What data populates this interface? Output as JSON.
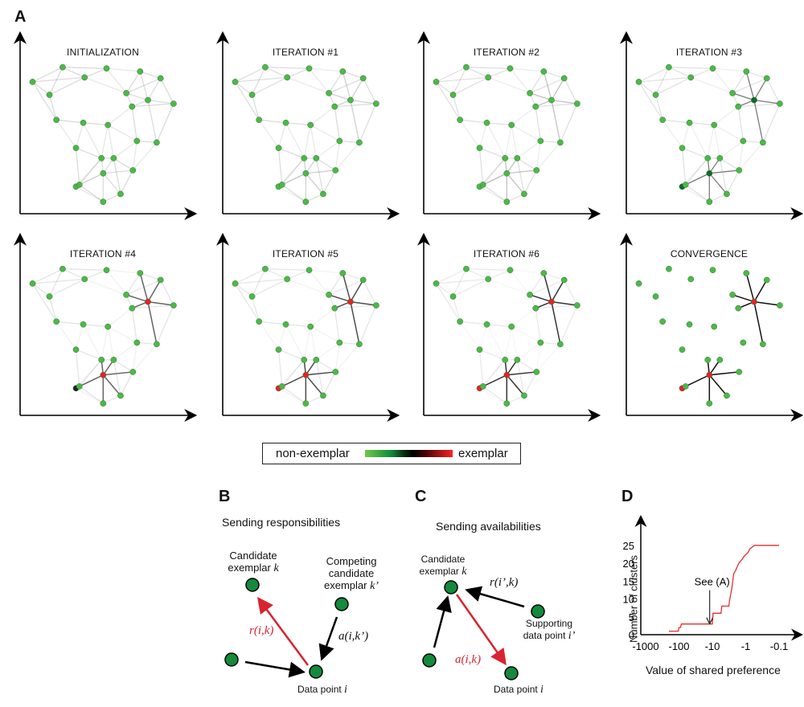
{
  "figure": {
    "panel_letters": {
      "a": "A",
      "b": "B",
      "c": "C",
      "d": "D"
    },
    "panels_a": [
      {
        "title": "INITIALIZATION",
        "stage": 0
      },
      {
        "title": "ITERATION #1",
        "stage": 1
      },
      {
        "title": "ITERATION #2",
        "stage": 2
      },
      {
        "title": "ITERATION #3",
        "stage": 3
      },
      {
        "title": "ITERATION #4",
        "stage": 4
      },
      {
        "title": "ITERATION #5",
        "stage": 5
      },
      {
        "title": "ITERATION #6",
        "stage": 6
      },
      {
        "title": "CONVERGENCE",
        "stage": 7
      }
    ],
    "legend": {
      "left_label": "non-exemplar",
      "right_label": "exemplar",
      "colors": {
        "non_exemplar": "#6fc84a",
        "middle": "#000000",
        "exemplar": "#ff2020"
      }
    },
    "panel_b": {
      "title": "Sending responsibilities",
      "candidate_label_1": "Candidate",
      "candidate_label_2": "exemplar",
      "candidate_var": "k",
      "competing_label_1": "Competing",
      "competing_label_2": "candidate",
      "competing_label_3": "exemplar",
      "competing_var": "k’",
      "data_point_label": "Data point",
      "data_point_var": "i",
      "message_red": "r(i,k)",
      "message_black": "a(i,k’)"
    },
    "panel_c": {
      "title": "Sending availabilities",
      "candidate_label_1": "Candidate",
      "candidate_label_2": "exemplar",
      "candidate_var": "k",
      "supporting_label_1": "Supporting",
      "supporting_label_2": "data point",
      "supporting_var": "i’",
      "data_point_label": "Data point",
      "data_point_var": "i",
      "message_red": "a(i,k)",
      "message_black": "r(i’,k)"
    },
    "colors": {
      "node_green": "#4cb848",
      "node_dark_green": "#0e6b2e",
      "exemplar_red": "#e8202a",
      "message_red": "#d9232e",
      "diagram_node": "#138a3c"
    }
  },
  "chart_data": {
    "type": "line",
    "title": "",
    "xlabel": "Value of shared preference",
    "ylabel": "Number of clusters",
    "x_scale": "log-negative",
    "x_ticks": [
      "-1000",
      "-100",
      "-10",
      "-1",
      "-0.1"
    ],
    "x_tick_values": [
      -1000,
      -100,
      -10,
      -1,
      -0.1
    ],
    "y_ticks": [
      "0",
      "5",
      "10",
      "15",
      "20",
      "25"
    ],
    "y_tick_values": [
      0,
      5,
      10,
      15,
      20,
      25
    ],
    "ylim": [
      0,
      28
    ],
    "grid": false,
    "series": [
      {
        "name": "clusters",
        "color": "#e03030",
        "step": true,
        "points": [
          [
            -200,
            1
          ],
          [
            -105,
            1
          ],
          [
            -100,
            2
          ],
          [
            -90,
            2
          ],
          [
            -85,
            3
          ],
          [
            -60,
            3
          ],
          [
            -10,
            3
          ],
          [
            -9.5,
            6
          ],
          [
            -5.5,
            6
          ],
          [
            -5.2,
            8
          ],
          [
            -3.2,
            8
          ],
          [
            -3,
            10
          ],
          [
            -2.6,
            13
          ],
          [
            -2.3,
            17
          ],
          [
            -2.0,
            18
          ],
          [
            -1.8,
            19
          ],
          [
            -1.6,
            20
          ],
          [
            -1.3,
            21
          ],
          [
            -1.1,
            22
          ],
          [
            -0.85,
            23
          ],
          [
            -0.75,
            24
          ],
          [
            -0.55,
            25
          ],
          [
            -0.1,
            25
          ]
        ]
      }
    ],
    "annotations": [
      {
        "text": "See (A)",
        "x": -12,
        "y": 3,
        "arrow": "down"
      }
    ]
  },
  "graph": {
    "nodes": [
      [
        0.331,
        0.159
      ],
      [
        0.252,
        0.86
      ],
      [
        0.512,
        0.853
      ],
      [
        0.382,
        0.8
      ],
      [
        0.074,
        0.774
      ],
      [
        0.174,
        0.698
      ],
      [
        0.215,
        0.551
      ],
      [
        0.374,
        0.534
      ],
      [
        0.52,
        0.521
      ],
      [
        0.757,
        0.667
      ],
      [
        0.711,
        0.835
      ],
      [
        0.832,
        0.795
      ],
      [
        0.629,
        0.708
      ],
      [
        0.663,
        0.629
      ],
      [
        0.909,
        0.646
      ],
      [
        0.692,
        0.427
      ],
      [
        0.809,
        0.418
      ],
      [
        0.492,
        0.237
      ],
      [
        0.331,
        0.386
      ],
      [
        0.482,
        0.326
      ],
      [
        0.554,
        0.326
      ],
      [
        0.668,
        0.255
      ],
      [
        0.351,
        0.17
      ],
      [
        0.595,
        0.116
      ],
      [
        0.492,
        0.07
      ]
    ],
    "clusters": [
      0,
      0,
      0,
      0,
      0,
      0,
      0,
      0,
      0,
      1,
      1,
      1,
      1,
      1,
      1,
      1,
      1,
      2,
      2,
      2,
      2,
      2,
      2,
      2,
      2
    ],
    "exemplars": [
      0,
      9,
      17
    ]
  }
}
